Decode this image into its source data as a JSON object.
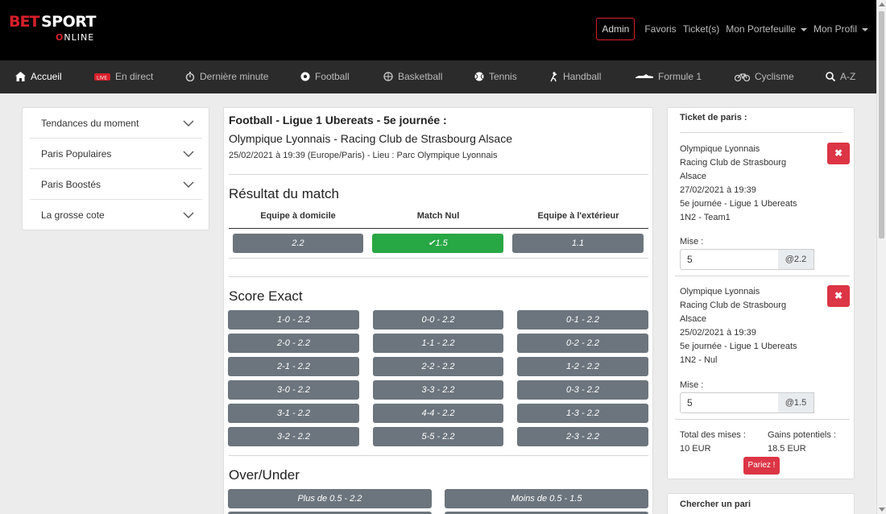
{
  "brand": {
    "bet": "BET",
    "sport": "SPORT",
    "online_pre": "O",
    "online_rest": "NLINE"
  },
  "topnav": {
    "admin": "Admin",
    "favoris": "Favoris",
    "tickets": "Ticket(s)",
    "portefeuille": "Mon Portefeuille",
    "profil": "Mon Profil"
  },
  "sports": [
    "Accueil",
    "En direct",
    "Dernière minute",
    "Football",
    "Basketball",
    "Tennis",
    "Handball",
    "Formule 1",
    "Cyclisme",
    "A-Z"
  ],
  "left_menu": [
    "Tendances du moment",
    "Paris Populaires",
    "Paris Boostés",
    "La grosse cote"
  ],
  "match": {
    "line1": "Football - Ligue 1 Ubereats - 5e journée :",
    "line2": "Olympique Lyonnais - Racing Club de Strasbourg Alsace",
    "line3": "25/02/2021 à 19:39 (Europe/Paris) - Lieu : Parc Olympique Lyonnais"
  },
  "result": {
    "title": "Résultat du match",
    "headers": [
      "Equipe à domicile",
      "Match Nul",
      "Equipe à l'extérieur"
    ],
    "odds": [
      "2.2",
      "1.5",
      "1.1"
    ]
  },
  "score_exact": {
    "title": "Score Exact",
    "rows": [
      [
        "1-0 - 2.2",
        "0-0 - 2.2",
        "0-1 - 2.2"
      ],
      [
        "2-0 - 2.2",
        "1-1 - 2.2",
        "0-2 - 2.2"
      ],
      [
        "2-1 - 2.2",
        "2-2 - 2.2",
        "1-2 - 2.2"
      ],
      [
        "3-0 - 2.2",
        "3-3 - 2.2",
        "0-3 - 2.2"
      ],
      [
        "3-1 - 2.2",
        "4-4 - 2.2",
        "1-3 - 2.2"
      ],
      [
        "3-2 - 2.2",
        "5-5 - 2.2",
        "2-3 - 2.2"
      ]
    ]
  },
  "over_under": {
    "title": "Over/Under",
    "plus": "Plus de 0.5 - 2.2",
    "moins": "Moins de 0.5 - 1.5"
  },
  "ticket": {
    "title": "Ticket de paris :",
    "bets": [
      {
        "team1": "Olympique Lyonnais",
        "team2a": "Racing Club de Strasbourg",
        "team2b": "Alsace",
        "date": "27/02/2021 à 19:39",
        "league": "5e journée - Ligue 1 Ubereats",
        "pick": "1N2 - Team1",
        "mise_label": "Mise :",
        "mise": "5",
        "odd": "@2.2"
      },
      {
        "team1": "Olympique Lyonnais",
        "team2a": "Racing Club de Strasbourg",
        "team2b": "Alsace",
        "date": "25/02/2021 à 19:39",
        "league": "5e journée - Ligue 1 Ubereats",
        "pick": "1N2 - Nul",
        "mise_label": "Mise :",
        "mise": "5",
        "odd": "@1.5"
      }
    ],
    "total_label": "Total des mises :",
    "total_value": "10 EUR",
    "gains_label": "Gains potentiels :",
    "gains_value": "18.5 EUR",
    "submit": "Pariez !"
  },
  "search_panel": {
    "title": "Chercher un pari"
  },
  "colors": {
    "brand_red": "#d71f2a",
    "grey_btn": "#6c757d",
    "green_btn": "#28a745",
    "danger": "#dc3545"
  }
}
